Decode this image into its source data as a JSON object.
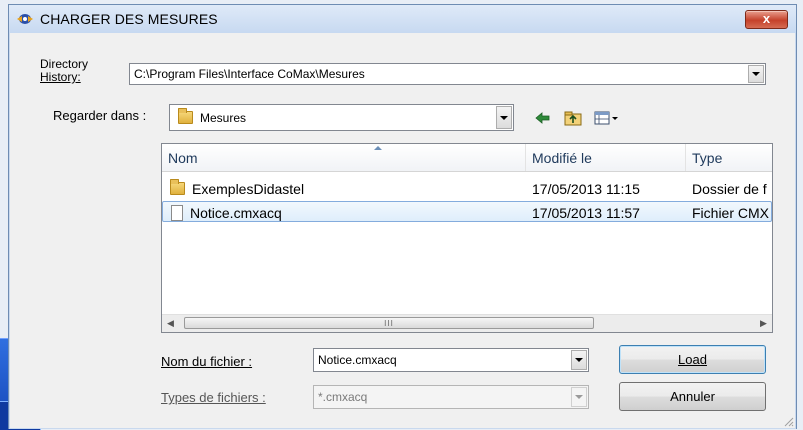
{
  "background": {
    "accent": "#1546b8"
  },
  "dialog": {
    "title": "CHARGER DES MESURES",
    "title_icon": "compass-icon",
    "close_label": "x",
    "directory_history": {
      "label_line1": "Directory",
      "label_line2": "History:",
      "value": "C:\\Program Files\\Interface CoMax\\Mesures"
    },
    "look_in": {
      "label": "Regarder dans :",
      "value": "Mesures"
    },
    "toolbar": {
      "icons": [
        "back-arrow-icon",
        "up-folder-icon",
        "view-menu-icon"
      ]
    },
    "list": {
      "columns": [
        "Nom",
        "Modifié le",
        "Type"
      ],
      "rows": [
        {
          "name": "ExemplesDidastel",
          "modified": "17/05/2013 11:15",
          "type": "Dossier de f",
          "icon": "folder-icon",
          "selected": false
        },
        {
          "name": "Notice.cmxacq",
          "modified": "17/05/2013 11:57",
          "type": "Fichier CMX",
          "icon": "file-icon",
          "selected": true
        }
      ],
      "scroll_grip": "III"
    },
    "filename": {
      "label": "Nom du fichier :",
      "value": "Notice.cmxacq"
    },
    "filetype": {
      "label": "Types de fichiers :",
      "value": "*.cmxacq"
    },
    "buttons": {
      "load": "Load",
      "cancel": "Annuler"
    }
  }
}
